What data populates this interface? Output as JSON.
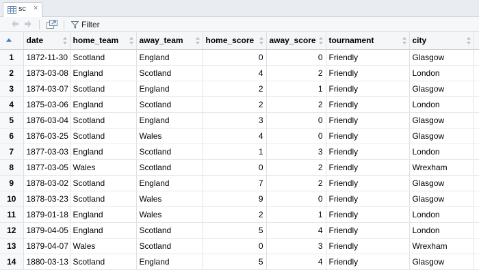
{
  "tab": {
    "label": "sc",
    "close": "×"
  },
  "toolbar": {
    "filter_label": "Filter"
  },
  "table": {
    "columns": [
      "date",
      "home_team",
      "away_team",
      "home_score",
      "away_score",
      "tournament",
      "city"
    ],
    "rows": [
      [
        "1",
        "1872-11-30",
        "Scotland",
        "England",
        "0",
        "0",
        "Friendly",
        "Glasgow"
      ],
      [
        "2",
        "1873-03-08",
        "England",
        "Scotland",
        "4",
        "2",
        "Friendly",
        "London"
      ],
      [
        "3",
        "1874-03-07",
        "Scotland",
        "England",
        "2",
        "1",
        "Friendly",
        "Glasgow"
      ],
      [
        "4",
        "1875-03-06",
        "England",
        "Scotland",
        "2",
        "2",
        "Friendly",
        "London"
      ],
      [
        "5",
        "1876-03-04",
        "Scotland",
        "England",
        "3",
        "0",
        "Friendly",
        "Glasgow"
      ],
      [
        "6",
        "1876-03-25",
        "Scotland",
        "Wales",
        "4",
        "0",
        "Friendly",
        "Glasgow"
      ],
      [
        "7",
        "1877-03-03",
        "England",
        "Scotland",
        "1",
        "3",
        "Friendly",
        "London"
      ],
      [
        "8",
        "1877-03-05",
        "Wales",
        "Scotland",
        "0",
        "2",
        "Friendly",
        "Wrexham"
      ],
      [
        "9",
        "1878-03-02",
        "Scotland",
        "England",
        "7",
        "2",
        "Friendly",
        "Glasgow"
      ],
      [
        "10",
        "1878-03-23",
        "Scotland",
        "Wales",
        "9",
        "0",
        "Friendly",
        "Glasgow"
      ],
      [
        "11",
        "1879-01-18",
        "England",
        "Wales",
        "2",
        "1",
        "Friendly",
        "London"
      ],
      [
        "12",
        "1879-04-05",
        "England",
        "Scotland",
        "5",
        "4",
        "Friendly",
        "London"
      ],
      [
        "13",
        "1879-04-07",
        "Wales",
        "Scotland",
        "0",
        "3",
        "Friendly",
        "Wrexham"
      ],
      [
        "14",
        "1880-03-13",
        "Scotland",
        "England",
        "5",
        "4",
        "Friendly",
        "Glasgow"
      ]
    ]
  },
  "colors": {
    "accent": "#3d7cc9",
    "header_bg": "#f4f6f8",
    "tabbar_bg": "#e9edf2"
  }
}
